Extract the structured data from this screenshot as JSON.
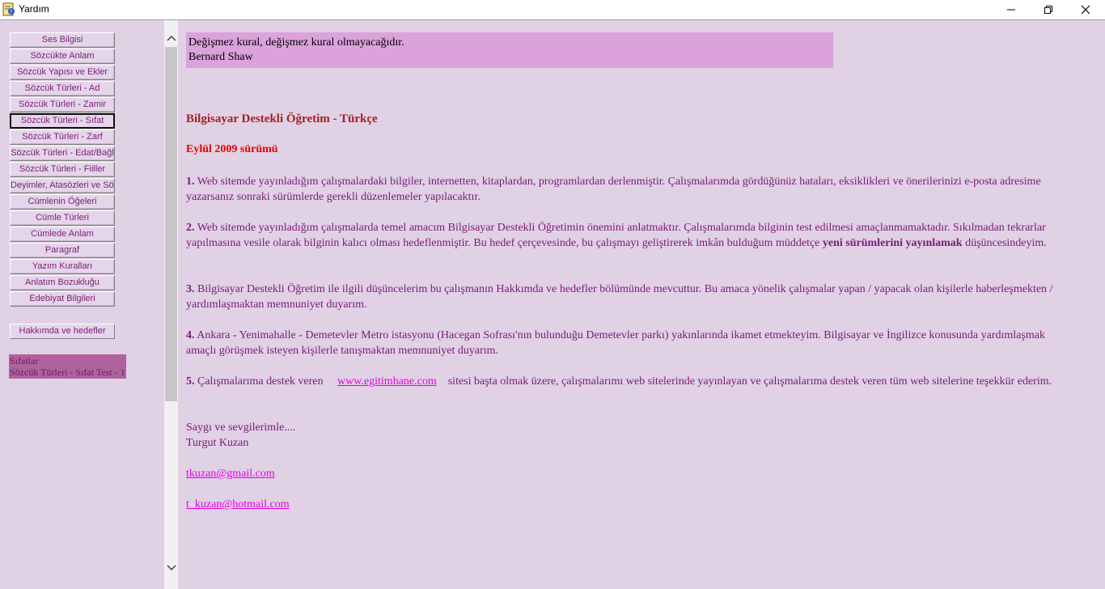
{
  "window": {
    "title": "Yardım"
  },
  "sidebar": {
    "items": [
      {
        "label": "Ses Bilgisi"
      },
      {
        "label": "Sözcükte Anlam"
      },
      {
        "label": "Sözcük Yapısı ve Ekler"
      },
      {
        "label": "Sözcük Türleri - Ad"
      },
      {
        "label": "Sözcük Türleri - Zamir"
      },
      {
        "label": "Sözcük Türleri - Sıfat"
      },
      {
        "label": "Sözcük Türleri - Zarf"
      },
      {
        "label": "Sözcük Türleri - Edat/Bağl"
      },
      {
        "label": "Sözcük Türleri - Fiiller"
      },
      {
        "label": "Deyimler, Atasözleri ve Söz"
      },
      {
        "label": "Cümlenin Öğeleri"
      },
      {
        "label": "Cümle Türleri"
      },
      {
        "label": "Cümlede Anlam"
      },
      {
        "label": "Paragraf"
      },
      {
        "label": "Yazım Kuralları"
      },
      {
        "label": "Anlatım Bozukluğu"
      },
      {
        "label": "Edebiyat Bilgileri"
      }
    ],
    "about_label": "Hakkımda ve hedefler",
    "subitems": [
      "Sıfatlar",
      "Sözcük Türleri - Sıfat Test - 1"
    ]
  },
  "content": {
    "quote_line1": "Değişmez kural, değişmez kural olmayacağıdır.",
    "quote_line2": "Bernard Shaw",
    "title": "Bilgisayar Destekli Öğretim - Türkçe",
    "version": "Eylül 2009 sürümü",
    "p1_num": "1.",
    "p1_text": "Web sitemde yayınladığım çalışmalardaki bilgiler, internetten, kitaplardan, programlardan derlenmiştir. Çalışmalarımda gördüğünüz hataları, eksiklikleri ve önerilerinizi e-posta adresime yazarsanız sonraki sürümlerde gerekli düzenlemeler yapılacaktır.",
    "p2_num": "2.",
    "p2_text": "Web sitemde yayınladığım çalışmalarda temel amacım Bilgisayar Destekli Öğretimin önemini anlatmaktır. Çalışmalarımda bilginin test edilmesi amaçlanmamaktadır. Sıkılmadan tekrarlar yapılmasına vesile olarak bilginin kalıcı olması hedeflenmiştir. Bu hedef çerçevesinde, bu çalışmayı geliştirerek imkân bulduğum müddetçe",
    "p2_bold": "yeni sürümlerini yayınlamak",
    "p2_tail": "düşüncesindeyim.",
    "p3_num": "3.",
    "p3_text": "Bilgisayar Destekli Öğretim ile ilgili düşüncelerim bu çalışmanın Hakkımda ve hedefler bölümünde mevcuttur. Bu amaca yönelik çalışmalar yapan / yapacak olan kişilerle haberleşmekten / yardımlaşmaktan memnuniyet duyarım.",
    "p4_num": "4.",
    "p4_text": "Ankara - Yenimahalle - Demetevler Metro istasyonu (Hacegan Sofrası'nın bulunduğu Demetevler parkı) yakınlarında ikamet etmekteyim. Bilgisayar ve İngilizce konusunda yardımlaşmak amaçlı görüşmek isteyen kişilerle tanışmaktan memnuniyet duyarım.",
    "p5_num": "5.",
    "p5_pre": "Çalışmalarıma destek veren",
    "p5_link": "www.egitimhane.com",
    "p5_post": "sitesi başta olmak üzere, çalışmalarımı web sitelerinde yayınlayan ve çalışmalarıma destek veren tüm web sitelerine teşekkür ederim.",
    "regards": "Saygı ve sevgilerimle....",
    "author": "Turgut Kuzan",
    "email1": "tkuzan@gmail.com",
    "email2": "t_kuzan@hotmail.com"
  }
}
